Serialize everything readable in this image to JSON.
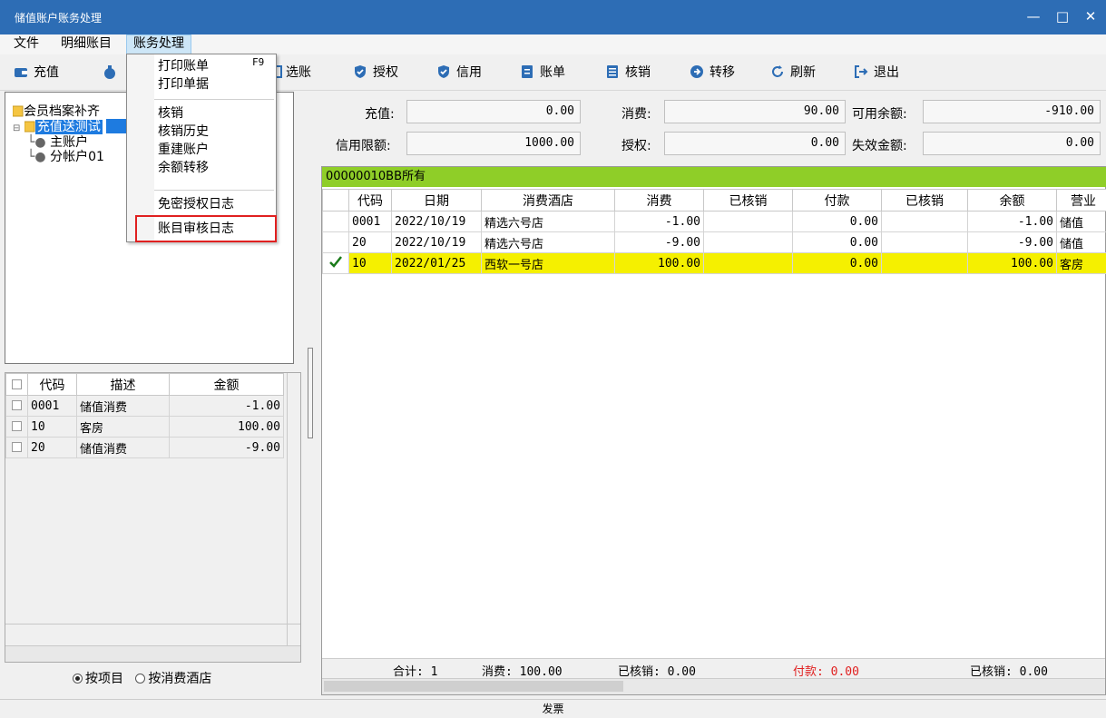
{
  "window": {
    "title": "储值账户账务处理",
    "controls": [
      "—",
      "□",
      "✕"
    ]
  },
  "menubar": [
    "文件",
    "明细账目",
    "账务处理"
  ],
  "toolbar": [
    {
      "label": "充值",
      "icon": "wallet-icon"
    },
    {
      "label": "",
      "icon": "money-bag-icon"
    },
    {
      "label": "选账",
      "icon": "select-icon"
    },
    {
      "label": "授权",
      "icon": "shield-check-icon"
    },
    {
      "label": "信用",
      "icon": "shield-check-icon"
    },
    {
      "label": "账单",
      "icon": "document-icon"
    },
    {
      "label": "核销",
      "icon": "list-icon"
    },
    {
      "label": "转移",
      "icon": "arrow-circle-icon"
    },
    {
      "label": "刷新",
      "icon": "refresh-icon"
    },
    {
      "label": "退出",
      "icon": "exit-icon"
    }
  ],
  "dropdown": {
    "items": [
      {
        "label": "打印账单",
        "shortcut": "F9"
      },
      {
        "label": "打印单据"
      },
      {
        "label": "核销"
      },
      {
        "label": "核销历史"
      },
      {
        "label": "重建账户"
      },
      {
        "label": "余额转移"
      },
      {
        "label": "免密授权日志"
      },
      {
        "label": "账目审核日志"
      }
    ]
  },
  "tree": {
    "root": "会员档案补齐",
    "selected": "充值送测试",
    "children": [
      "主账户",
      "分帐户01"
    ]
  },
  "left_grid": {
    "headers": [
      "代码",
      "描述",
      "金额"
    ],
    "rows": [
      {
        "code": "0001",
        "desc": "储值消费",
        "amount": "-1.00"
      },
      {
        "code": "10",
        "desc": "客房",
        "amount": "100.00"
      },
      {
        "code": "20",
        "desc": "储值消费",
        "amount": "-9.00"
      }
    ]
  },
  "radios": {
    "by_item": "按项目",
    "by_hotel": "按消费酒店"
  },
  "summary": {
    "recharge_label": "充值:",
    "recharge": "0.00",
    "consume_label": "消费:",
    "consume": "90.00",
    "available_label": "可用余额:",
    "available": "-910.00",
    "credit_label": "信用限额:",
    "credit": "1000.00",
    "auth_label": "授权:",
    "auth": "0.00",
    "expired_label": "失效金额:",
    "expired": "0.00"
  },
  "right_grid": {
    "title": "00000010BB所有",
    "headers": [
      "代码",
      "日期",
      "消费酒店",
      "消费",
      "已核销",
      "付款",
      "已核销",
      "余额",
      "营业"
    ],
    "rows": [
      {
        "code": "0001",
        "date": "2022/10/19",
        "hotel": "精选六号店",
        "consume": "-1.00",
        "written1": "",
        "pay": "0.00",
        "written2": "",
        "balance": "-1.00",
        "biz": "储值",
        "checked": false
      },
      {
        "code": "20",
        "date": "2022/10/19",
        "hotel": "精选六号店",
        "consume": "-9.00",
        "written1": "",
        "pay": "0.00",
        "written2": "",
        "balance": "-9.00",
        "biz": "储值",
        "checked": false
      },
      {
        "code": "10",
        "date": "2022/01/25",
        "hotel": "西软一号店",
        "consume": "100.00",
        "written1": "",
        "pay": "0.00",
        "written2": "",
        "balance": "100.00",
        "biz": "客房",
        "checked": true
      }
    ],
    "footer": {
      "total": "合计: 1",
      "consume": "消费: 100.00",
      "written": "已核销: 0.00",
      "pay": "付款: 0.00",
      "written2": "已核销: 0.00"
    }
  },
  "status": "发票",
  "colors": {
    "titlebar": "#2d6db5",
    "grid_title": "#8fce28",
    "selected_row": "#f5f000",
    "pay_text": "#e02020",
    "highlight_box": "#e02020"
  }
}
